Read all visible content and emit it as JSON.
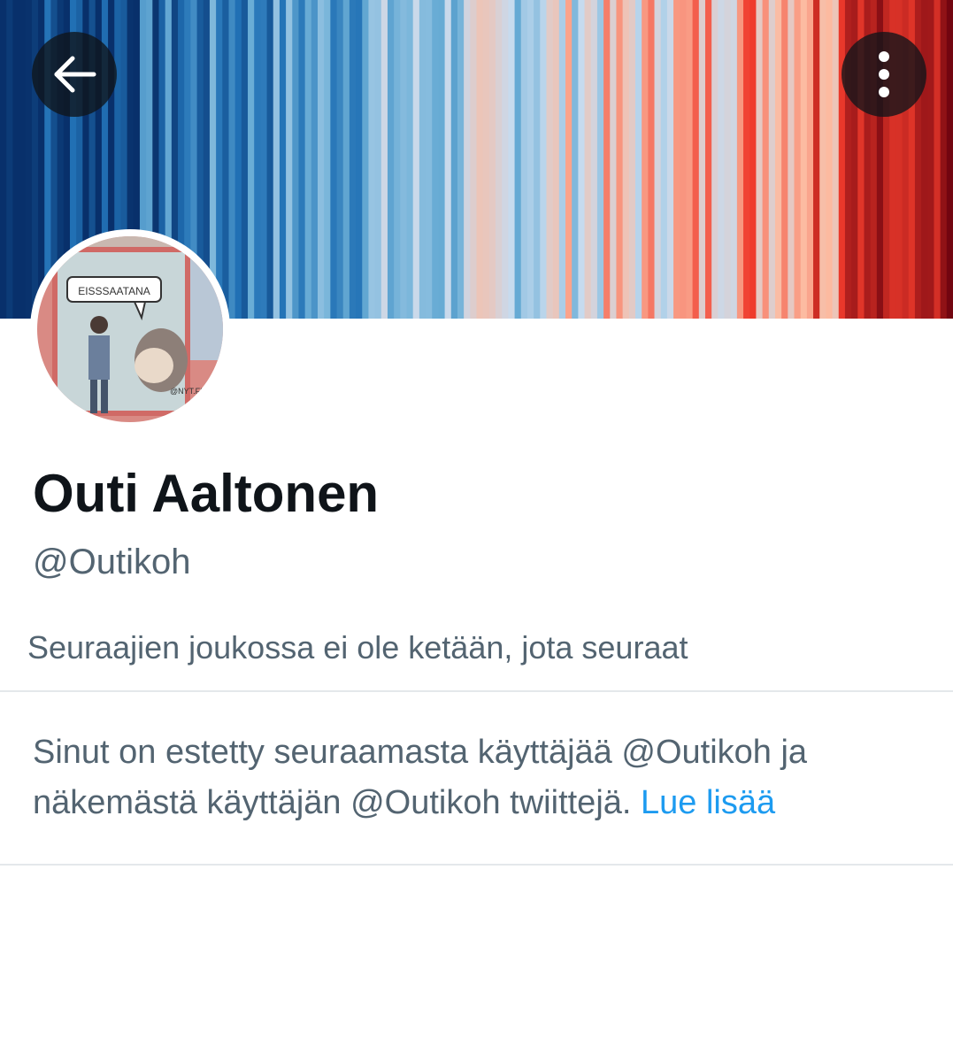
{
  "header": {
    "back_icon": "arrow-left-icon",
    "more_icon": "more-vertical-icon",
    "button_bg": "#0f1419"
  },
  "banner": {
    "description": "warming-stripes",
    "colors": [
      "#08306b",
      "#2171b5",
      "#6baed6",
      "#c6dbef",
      "#fcbba1",
      "#ef3b2c",
      "#67000d"
    ]
  },
  "avatar": {
    "speech_text": "EISSSAATANA",
    "watermark": "@NYT.FI"
  },
  "profile": {
    "display_name": "Outi Aaltonen",
    "handle": "@Outikoh",
    "followers_note": "Seuraajien joukossa ei ole ketään, jota seuraat"
  },
  "blocked": {
    "message": "Sinut on estetty seuraamasta käyttäjää @Outikoh ja näkemästä käyttäjän @Outikoh twiittejä.",
    "link_label": "Lue lisää",
    "link_color": "#1d9bf0"
  }
}
